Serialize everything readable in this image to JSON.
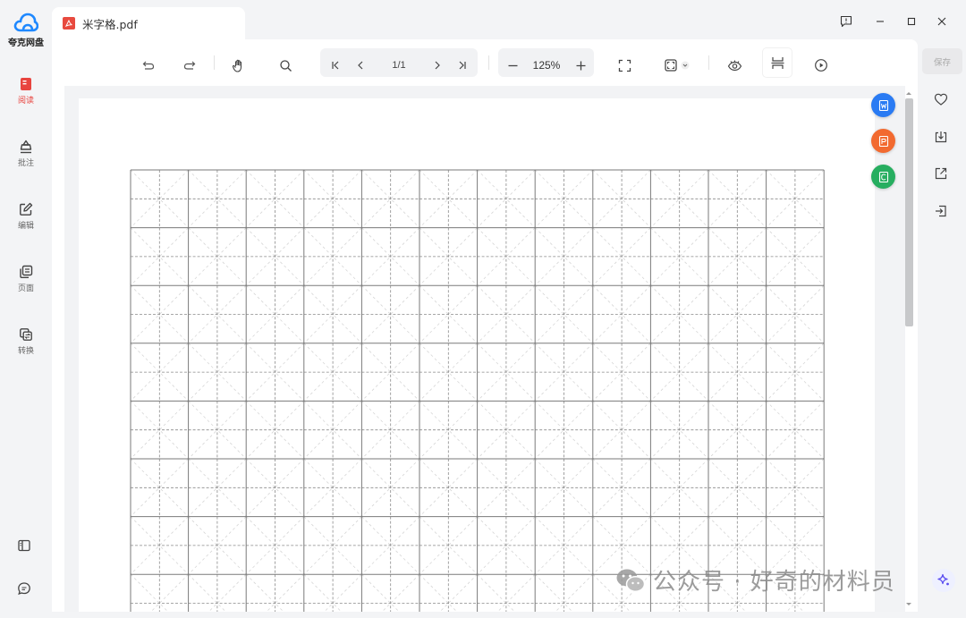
{
  "app": {
    "logo_text": "夸克网盘",
    "brand_color": "#1e88ff"
  },
  "sidebar": {
    "items": [
      {
        "label": "阅读",
        "icon": "book-icon",
        "active": true
      },
      {
        "label": "批注",
        "icon": "annotate-icon",
        "active": false
      },
      {
        "label": "编辑",
        "icon": "edit-icon",
        "active": false
      },
      {
        "label": "页面",
        "icon": "pages-icon",
        "active": false
      },
      {
        "label": "转换",
        "icon": "convert-icon",
        "active": false
      }
    ],
    "bottom": [
      "panel-toggle-icon",
      "chat-icon"
    ]
  },
  "tab": {
    "title": "米字格.pdf",
    "icon": "pdf-icon"
  },
  "toolbar": {
    "page_indicator": "1/1",
    "zoom": "125%"
  },
  "right_panel": {
    "save_label": "保存",
    "icons": [
      "heart-icon",
      "download-icon",
      "share-icon",
      "exit-icon"
    ]
  },
  "float_buttons": [
    {
      "icon": "to-word-icon",
      "color": "#2a7bf3"
    },
    {
      "icon": "to-pdf-icon",
      "color": "#f26a30"
    },
    {
      "icon": "to-excel-icon",
      "color": "#27ae60"
    }
  ],
  "document": {
    "grid_columns": 12,
    "grid_rows": 8
  },
  "watermark": {
    "text": "公众号 · 好奇的材料员"
  },
  "colors": {
    "active_accent": "#e8443f"
  }
}
